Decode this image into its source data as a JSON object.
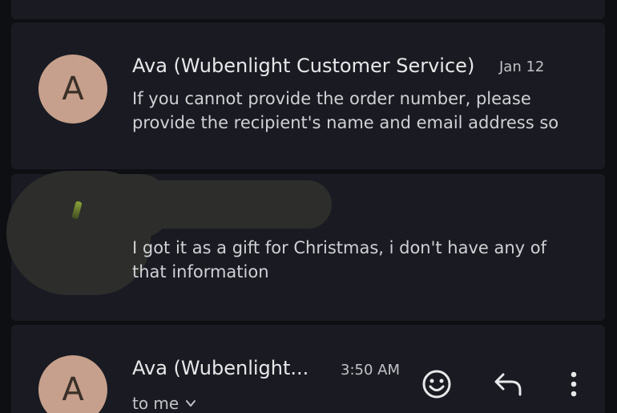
{
  "threads": [
    {
      "avatar_letter": "A",
      "sender": "Ava (Wubenlight Customer Service)",
      "date": "Jan 12",
      "snippet_line1": "If you cannot provide the order number, please",
      "snippet_line2": "provide the recipient's name and email address so"
    },
    {
      "snippet_line1": "I got it as a gift for Christmas, i don't have any of",
      "snippet_line2": "that information"
    }
  ],
  "expanded": {
    "avatar_letter": "A",
    "sender": "Ava (Wubenlight...",
    "time": "3:50 AM",
    "recipient": "to me"
  },
  "icons": {
    "reaction": "add-reaction-icon",
    "reply": "reply-icon",
    "more": "more-vert-icon",
    "chevron": "chevron-down-icon"
  },
  "colors": {
    "background": "#0e0f13",
    "card": "#1a1b22",
    "avatar": "#c6a08c",
    "text_primary": "#e8e8ea",
    "text_secondary": "#c2c3c7"
  }
}
